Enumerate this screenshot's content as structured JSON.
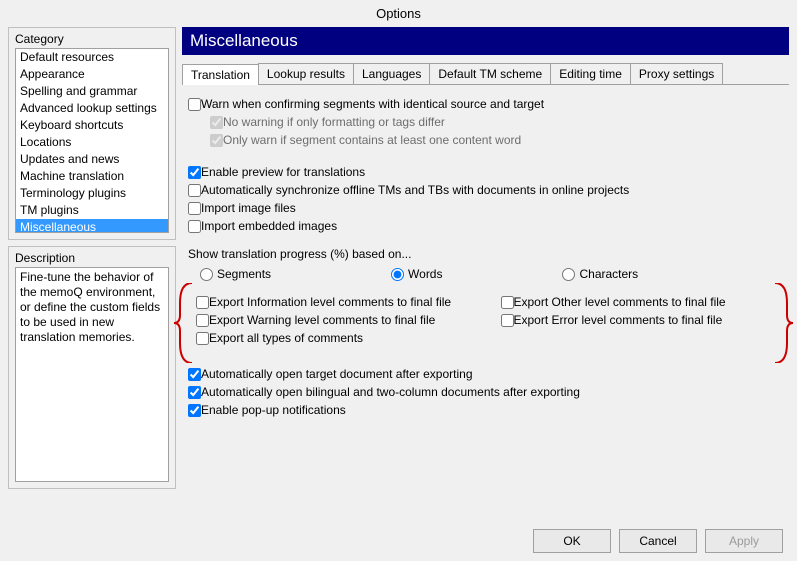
{
  "window_title": "Options",
  "left": {
    "category_label": "Category",
    "categories": [
      "Default resources",
      "Appearance",
      "Spelling and grammar",
      "Advanced lookup settings",
      "Keyboard shortcuts",
      "Locations",
      "Updates and news",
      "Machine translation",
      "Terminology plugins",
      "TM plugins",
      "Miscellaneous"
    ],
    "selected_index": 10,
    "description_label": "Description",
    "description_text": "Fine-tune the behavior of the memoQ environment, or define the custom fields to be used in new translation memories."
  },
  "right": {
    "header": "Miscellaneous",
    "tabs": [
      "Translation",
      "Lookup results",
      "Languages",
      "Default TM scheme",
      "Editing time",
      "Proxy settings"
    ],
    "active_tab": 0,
    "warn_identical": "Warn when confirming segments with identical source and target",
    "warn_sub1": "No warning if only formatting or tags differ",
    "warn_sub2": "Only warn if segment contains at least one content word",
    "enable_preview": "Enable preview for translations",
    "auto_sync": "Automatically synchronize offline TMs and TBs with documents in online projects",
    "import_image": "Import image files",
    "import_embedded": "Import embedded images",
    "progress_label": "Show translation progress (%) based on...",
    "radio_segments": "Segments",
    "radio_words": "Words",
    "radio_characters": "Characters",
    "export_info": "Export Information level comments to final file",
    "export_warning": "Export Warning level comments to final file",
    "export_all": "Export all types of comments",
    "export_other": "Export Other level comments to final file",
    "export_error": "Export Error level comments to final file",
    "auto_open_target": "Automatically open target document after exporting",
    "auto_open_bilingual": "Automatically open bilingual and two-column documents after exporting",
    "enable_popup": "Enable pop-up notifications"
  },
  "buttons": {
    "ok": "OK",
    "cancel": "Cancel",
    "apply": "Apply"
  }
}
